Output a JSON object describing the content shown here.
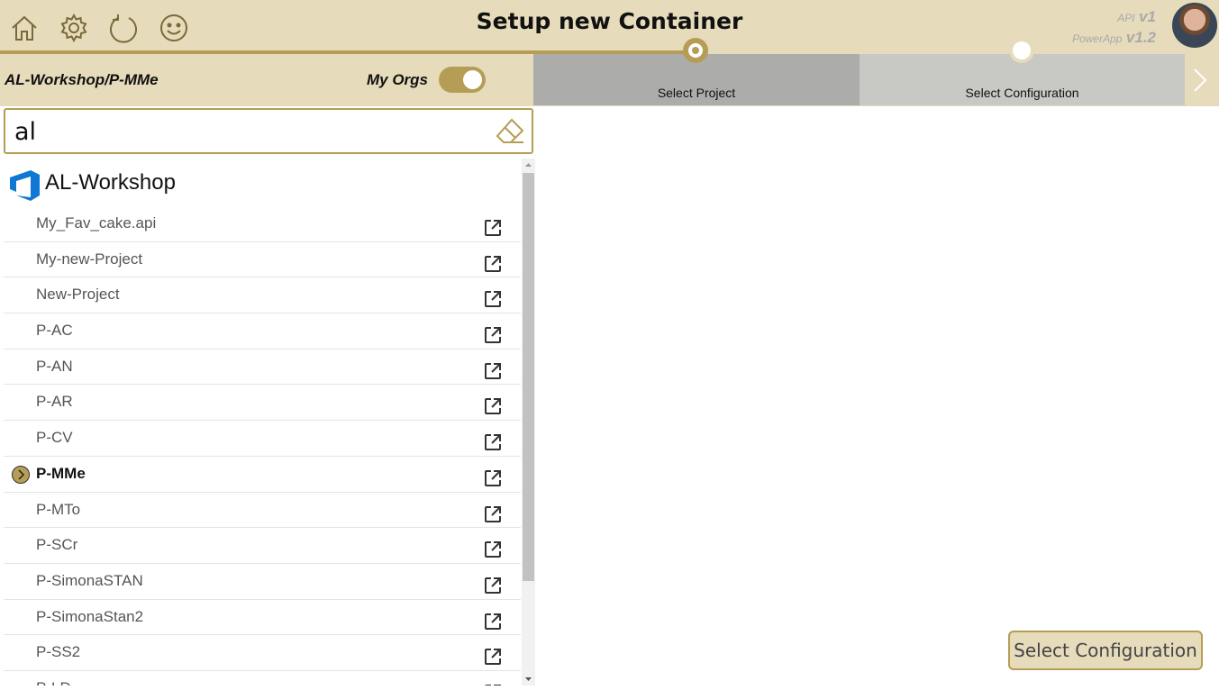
{
  "header": {
    "title": "Setup new Container",
    "icons": [
      "home-icon",
      "gear-icon",
      "refresh-icon",
      "smiley-icon"
    ],
    "version": {
      "api_label": "API",
      "api_value": "v1",
      "powerapp_label": "PowerApp",
      "powerapp_value": "v1.2"
    }
  },
  "subheader": {
    "breadcrumb": "AL-Workshop/P-MMe",
    "my_orgs_label": "My Orgs",
    "my_orgs_enabled": true
  },
  "steps": [
    {
      "label": "Select Project",
      "state": "active"
    },
    {
      "label": "Select Configuration",
      "state": "pending"
    }
  ],
  "search": {
    "value": "al"
  },
  "org": {
    "name": "AL-Workshop",
    "icon": "azure-devops-icon"
  },
  "projects": [
    {
      "label": "My_Fav_cake.api",
      "selected": false
    },
    {
      "label": "My-new-Project",
      "selected": false
    },
    {
      "label": "New-Project",
      "selected": false
    },
    {
      "label": "P-AC",
      "selected": false
    },
    {
      "label": "P-AN",
      "selected": false
    },
    {
      "label": "P-AR",
      "selected": false
    },
    {
      "label": "P-CV",
      "selected": false
    },
    {
      "label": "P-MMe",
      "selected": true
    },
    {
      "label": "P-MTo",
      "selected": false
    },
    {
      "label": "P-SCr",
      "selected": false
    },
    {
      "label": "P-SimonaSTAN",
      "selected": false
    },
    {
      "label": "P-SimonaStan2",
      "selected": false
    },
    {
      "label": "P-SS2",
      "selected": false
    },
    {
      "label": "P-LD",
      "selected": false
    }
  ],
  "footer": {
    "select_config_label": "Select Configuration"
  },
  "colors": {
    "accent": "#b69d55",
    "header_bg": "#e6dbbb",
    "step_active_bg": "#acacaa",
    "step_pending_bg": "#c8c8c5"
  }
}
